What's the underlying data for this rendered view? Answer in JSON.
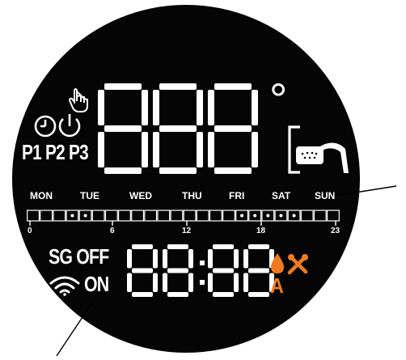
{
  "display": {
    "program_labels": [
      "P1",
      "P2",
      "P3"
    ],
    "temperature_digits": "888",
    "degree_symbol": "°",
    "days": [
      "MON",
      "TUE",
      "WED",
      "THU",
      "FRI",
      "SAT",
      "SUN"
    ],
    "hour_marks": [
      "0",
      "6",
      "12",
      "18",
      "23"
    ],
    "timeline": {
      "slot_count": 24,
      "active_slots": [
        3,
        4,
        16,
        17,
        18,
        19,
        20
      ]
    },
    "sg_off_label": "SG OFF",
    "on_label": "ON",
    "clock_digits": "88:88",
    "a_label": "A",
    "icons": [
      "clock-icon",
      "power-icon",
      "hand-pointer-icon",
      "shower-icon",
      "wifi-icon",
      "water-drop-icon",
      "tools-icon"
    ],
    "colors": {
      "background": "#050505",
      "segments": "#ffffff",
      "accent": "#f07a1f"
    }
  }
}
